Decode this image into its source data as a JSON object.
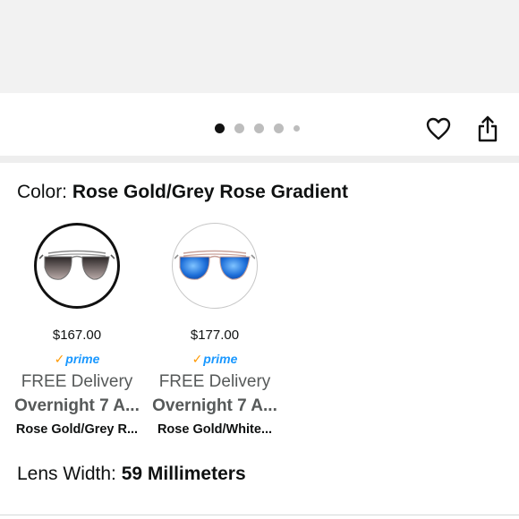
{
  "pagination": {
    "total_dots": 5,
    "active_index": 0
  },
  "actions": {
    "favorite_icon": "heart-icon",
    "share_icon": "share-icon"
  },
  "color_selector": {
    "label": "Color: ",
    "value": "Rose Gold/Grey Rose Gradient",
    "options": [
      {
        "price": "$167.00",
        "prime_label": "prime",
        "delivery": "FREE Delivery",
        "shipping": "Overnight 7 A...",
        "variant_name": "Rose Gold/Grey R...",
        "selected": true,
        "lens_color": "#3a3535"
      },
      {
        "price": "$177.00",
        "prime_label": "prime",
        "delivery": "FREE Delivery",
        "shipping": "Overnight 7 A...",
        "variant_name": "Rose Gold/White...",
        "selected": false,
        "lens_color": "#1e6fd9"
      }
    ]
  },
  "lens_width": {
    "label": "Lens Width: ",
    "value": "59 Millimeters"
  },
  "colors": {
    "prime_blue": "#1a98ff",
    "prime_check": "#ff9900",
    "active_dot": "#111111",
    "inactive_dot": "#bdbdbd"
  }
}
